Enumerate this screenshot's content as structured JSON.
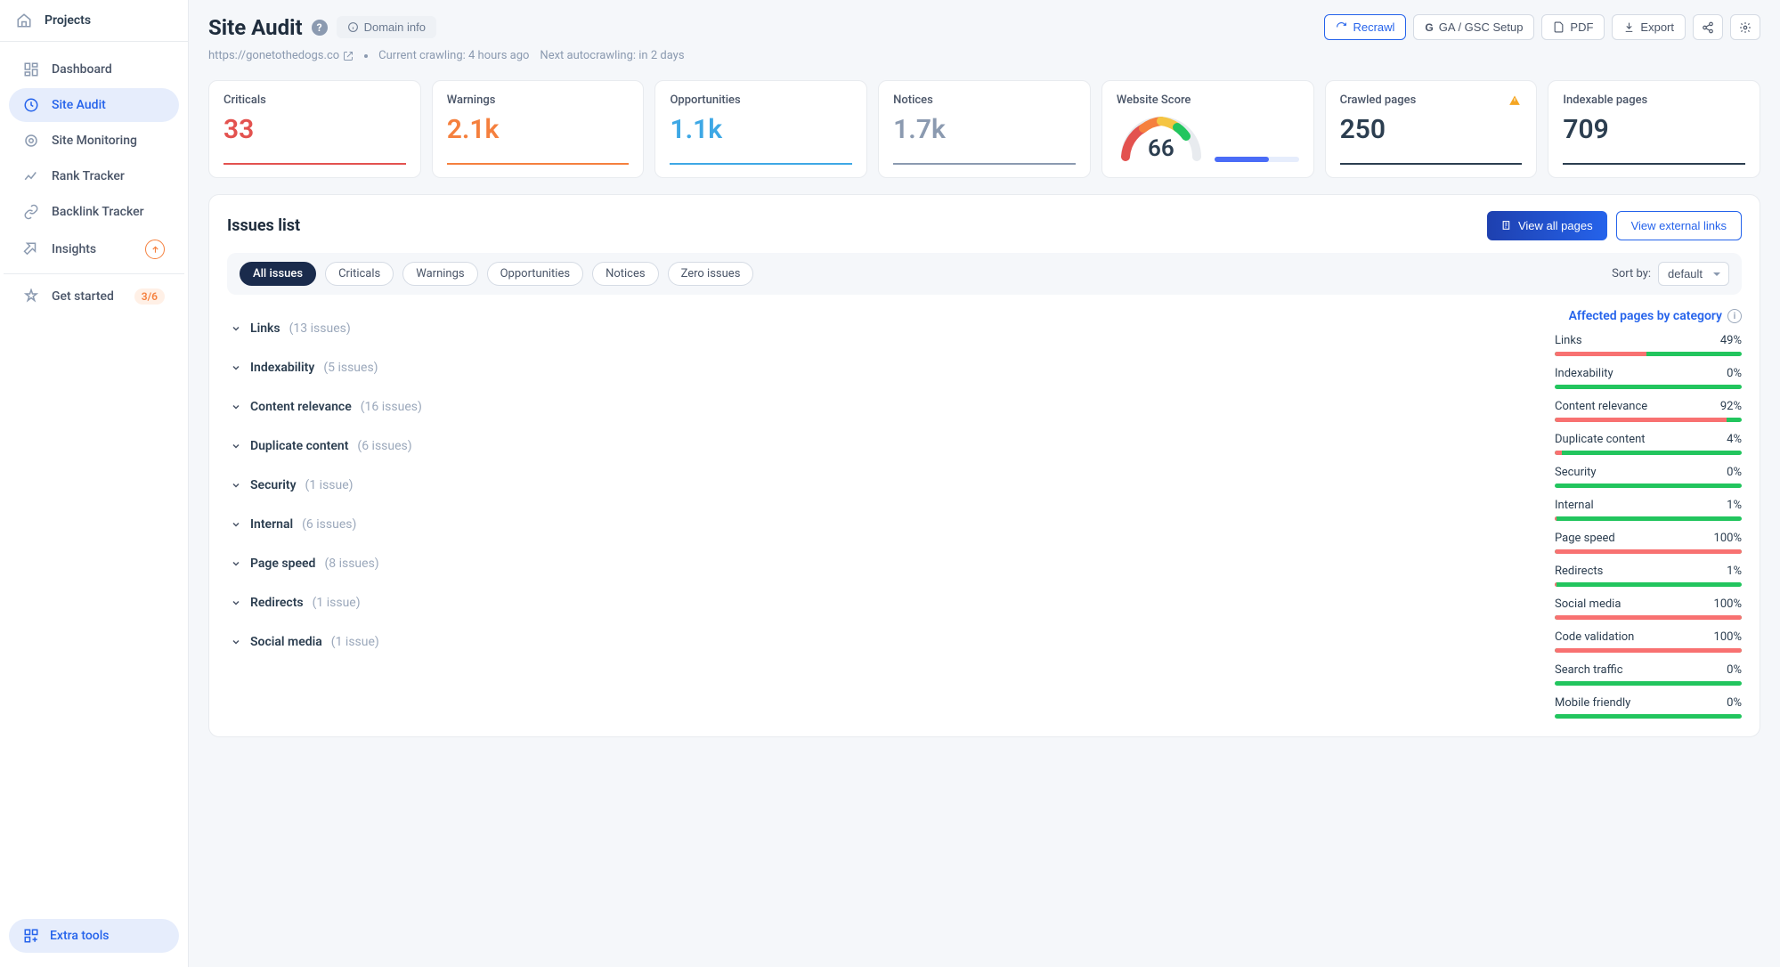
{
  "sidebar": {
    "header": "Projects",
    "nav": [
      {
        "label": "Dashboard",
        "icon": "dashboard-icon"
      },
      {
        "label": "Site Audit",
        "icon": "audit-icon",
        "active": true
      },
      {
        "label": "Site Monitoring",
        "icon": "monitoring-icon"
      },
      {
        "label": "Rank Tracker",
        "icon": "rank-icon"
      },
      {
        "label": "Backlink Tracker",
        "icon": "backlink-icon"
      },
      {
        "label": "Insights",
        "icon": "insights-icon",
        "upgrade": true
      }
    ],
    "get_started": {
      "label": "Get started",
      "badge": "3/6"
    },
    "extra_tools": "Extra tools"
  },
  "header": {
    "title": "Site Audit",
    "domain_info": "Domain info",
    "url": "https://gonetothedogs.co",
    "crawl_status": "Current crawling: 4 hours ago",
    "next_crawl": "Next autocrawling: in 2 days",
    "actions": {
      "recrawl": "Recrawl",
      "ga_gsc": "GA / GSC Setup",
      "pdf": "PDF",
      "export": "Export"
    }
  },
  "stats": {
    "criticals": {
      "label": "Criticals",
      "value": "33"
    },
    "warnings": {
      "label": "Warnings",
      "value": "2.1k"
    },
    "opportunities": {
      "label": "Opportunities",
      "value": "1.1k"
    },
    "notices": {
      "label": "Notices",
      "value": "1.7k"
    },
    "score": {
      "label": "Website Score",
      "value": "66"
    },
    "crawled": {
      "label": "Crawled pages",
      "value": "250"
    },
    "indexable": {
      "label": "Indexable pages",
      "value": "709"
    }
  },
  "issues": {
    "title": "Issues list",
    "view_all": "View all pages",
    "view_external": "View external links",
    "filters": [
      "All issues",
      "Criticals",
      "Warnings",
      "Opportunities",
      "Notices",
      "Zero issues"
    ],
    "sort_label": "Sort by:",
    "sort_value": "default",
    "list": [
      {
        "name": "Links",
        "count": "(13 issues)"
      },
      {
        "name": "Indexability",
        "count": "(5 issues)"
      },
      {
        "name": "Content relevance",
        "count": "(16 issues)"
      },
      {
        "name": "Duplicate content",
        "count": "(6 issues)"
      },
      {
        "name": "Security",
        "count": "(1 issue)"
      },
      {
        "name": "Internal",
        "count": "(6 issues)"
      },
      {
        "name": "Page speed",
        "count": "(8 issues)"
      },
      {
        "name": "Redirects",
        "count": "(1 issue)"
      },
      {
        "name": "Social media",
        "count": "(1 issue)"
      }
    ]
  },
  "affected": {
    "title": "Affected pages by category",
    "categories": [
      {
        "name": "Links",
        "pct": "49%",
        "fill": 49
      },
      {
        "name": "Indexability",
        "pct": "0%",
        "fill": 0
      },
      {
        "name": "Content relevance",
        "pct": "92%",
        "fill": 92
      },
      {
        "name": "Duplicate content",
        "pct": "4%",
        "fill": 4
      },
      {
        "name": "Security",
        "pct": "0%",
        "fill": 0
      },
      {
        "name": "Internal",
        "pct": "1%",
        "fill": 1
      },
      {
        "name": "Page speed",
        "pct": "100%",
        "fill": 100
      },
      {
        "name": "Redirects",
        "pct": "1%",
        "fill": 1
      },
      {
        "name": "Social media",
        "pct": "100%",
        "fill": 100
      },
      {
        "name": "Code validation",
        "pct": "100%",
        "fill": 100
      },
      {
        "name": "Search traffic",
        "pct": "0%",
        "fill": 0
      },
      {
        "name": "Mobile friendly",
        "pct": "0%",
        "fill": 0
      }
    ]
  }
}
